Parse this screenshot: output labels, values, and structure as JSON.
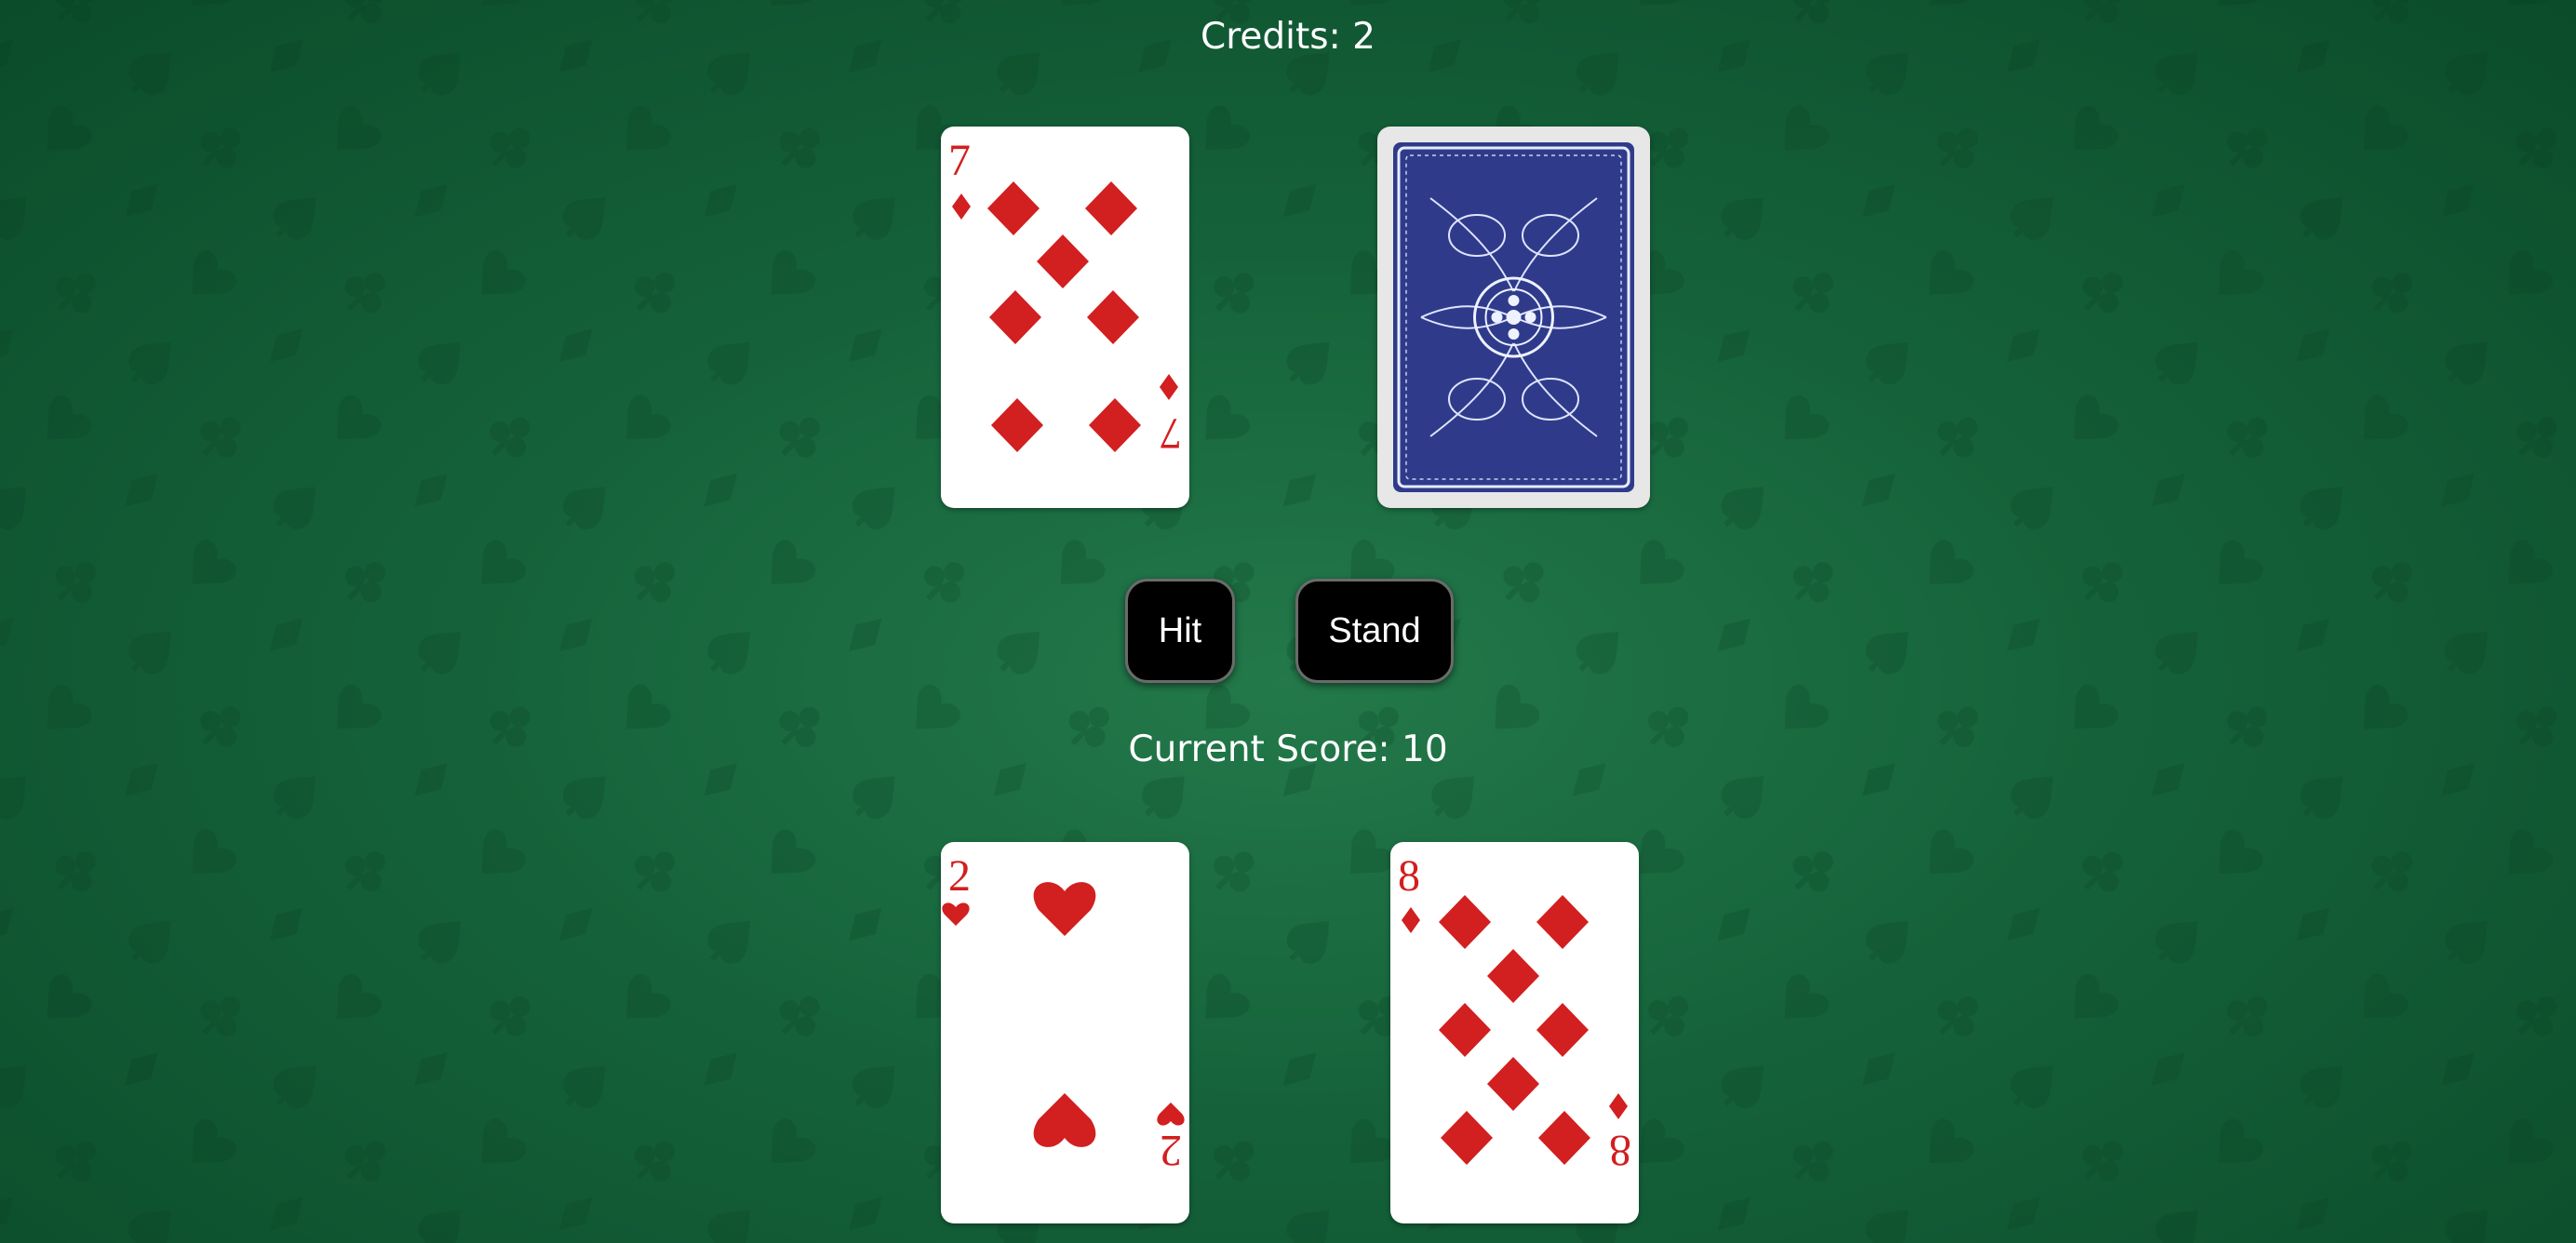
{
  "header": {
    "credits": "Credits: 2"
  },
  "dealer": {
    "cards": [
      {
        "rank": "7",
        "suit": "diamonds",
        "suit_symbol": "♦",
        "face_up": true
      },
      {
        "face_up": false,
        "back_color": "#2f3b8a"
      }
    ]
  },
  "controls": {
    "hit_label": "Hit",
    "stand_label": "Stand"
  },
  "player": {
    "score_label": "Current Score: 10",
    "cards": [
      {
        "rank": "2",
        "suit": "hearts",
        "suit_symbol": "♥",
        "face_up": true
      },
      {
        "rank": "8",
        "suit": "diamonds",
        "suit_symbol": "♦",
        "face_up": true
      }
    ]
  },
  "colors": {
    "felt": "#15623a",
    "card_red": "#d21f1f",
    "button_bg": "#000000",
    "button_text": "#ffffff"
  }
}
